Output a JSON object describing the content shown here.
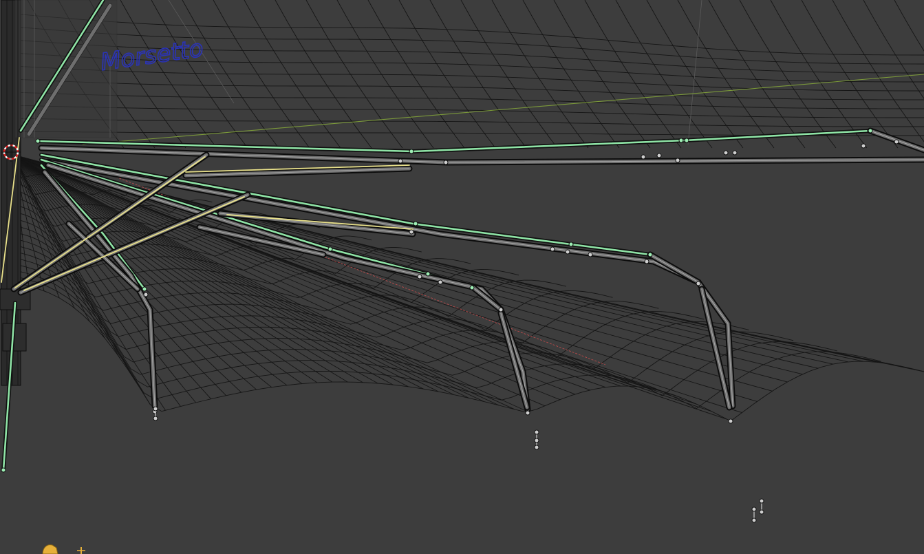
{
  "viewport": {
    "background": "#3d3d3d",
    "mesh_wire_color": "#151515",
    "selection_color": "#8fe4a6",
    "active_color": "#e8e08a",
    "axis_x_color": "#b84a4a",
    "axis_y_color": "#7c9a3a"
  },
  "scene_text": {
    "label": "Morsetto",
    "label_color": "#2a33b8"
  },
  "icons": {
    "cursor": "3d-cursor-icon",
    "gizmo": "axis-gizmo-icon"
  }
}
